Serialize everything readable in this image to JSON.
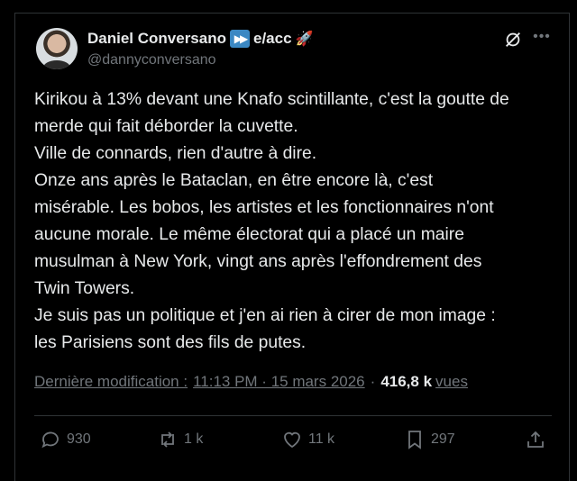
{
  "author": {
    "display_name": "Daniel Conversano",
    "name_suffix": "e/acc",
    "handle": "@dannyconversano"
  },
  "tweet": {
    "lines": [
      "Kirikou à 13% devant une Knafo scintillante, c'est la goutte de",
      "merde qui fait déborder la cuvette.",
      "Ville de connards, rien d'autre à dire.",
      "Onze ans après le Bataclan, en être encore là, c'est",
      "misérable. Les bobos, les artistes et les fonctionnaires n'ont",
      "aucune morale. Le même électorat qui a placé un maire",
      "musulman à New York, vingt ans après l'effondrement des",
      "Twin Towers.",
      "Je suis pas un politique et j'en ai rien à cirer de mon image :",
      "les Parisiens sont des fils de putes."
    ]
  },
  "meta": {
    "edited_label": "Dernière modification :",
    "timestamp": "11:13 PM · 15 mars 2026",
    "separator": "·",
    "view_count": "416,8 k",
    "views_label": "vues"
  },
  "actions": {
    "replies": "930",
    "reposts": "1 k",
    "likes": "11 k",
    "bookmarks": "297"
  },
  "colors": {
    "background": "#000000",
    "text": "#e7e9ea",
    "muted": "#71767b",
    "divider": "#2f3336"
  }
}
